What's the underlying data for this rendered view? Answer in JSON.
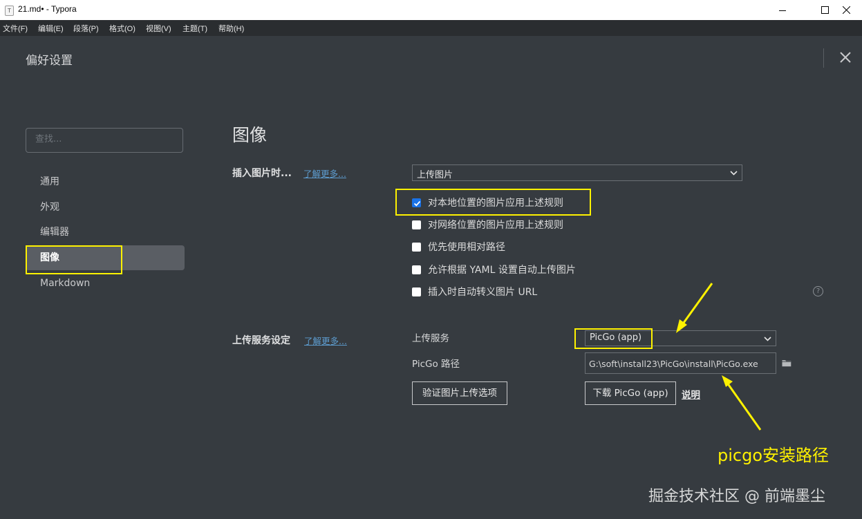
{
  "window": {
    "app_icon_letter": "T",
    "title": "21.md• - Typora",
    "controls": [
      "minimize-icon",
      "maximize-icon",
      "close-icon"
    ]
  },
  "menubar": {
    "items": [
      "文件(F)",
      "编辑(E)",
      "段落(P)",
      "格式(O)",
      "视图(V)",
      "主题(T)",
      "帮助(H)"
    ]
  },
  "preferences": {
    "title": "偏好设置",
    "search_placeholder": "查找...",
    "sidebar": [
      "通用",
      "外观",
      "编辑器",
      "图像",
      "Markdown"
    ],
    "active_index": 3
  },
  "image_section": {
    "title": "图像",
    "insert_label": "插入图片时...",
    "insert_learn_more": "了解更多...",
    "insert_action": "上传图片",
    "options": [
      {
        "label": "对本地位置的图片应用上述规则",
        "checked": true
      },
      {
        "label": "对网络位置的图片应用上述规则",
        "checked": false
      },
      {
        "label": "优先使用相对路径",
        "checked": false
      },
      {
        "label": "允许根据 YAML 设置自动上传图片",
        "checked": false
      },
      {
        "label": "插入时自动转义图片 URL",
        "checked": false
      }
    ],
    "help_symbol": "?",
    "upload_label": "上传服务设定",
    "upload_learn_more": "了解更多...",
    "upload_service_label": "上传服务",
    "upload_service_value": "PicGo (app)",
    "picgo_path_label": "PicGo 路径",
    "picgo_path_value": "G:\\soft\\install23\\PicGo\\install\\PicGo.exe",
    "verify_button": "验证图片上传选项",
    "download_button": "下载 PicGo (app)",
    "explain_link": "说明"
  },
  "annotations": {
    "highlight_color": "#fff200",
    "note": "picgo安装路径",
    "watermark": "掘金技术社区 @ 前端墨尘"
  }
}
